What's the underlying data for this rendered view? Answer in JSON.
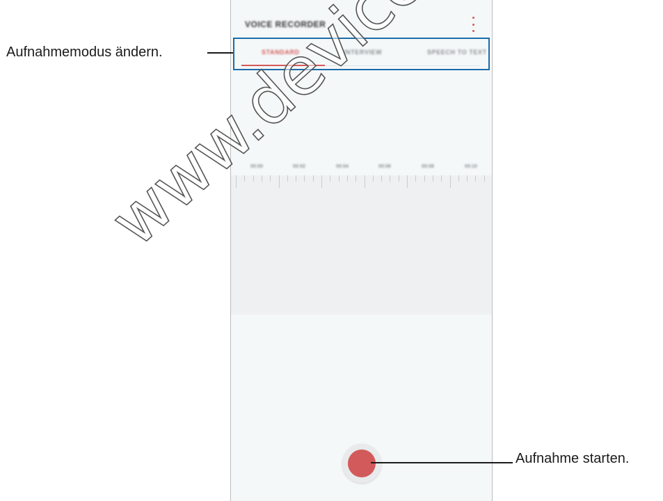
{
  "app": {
    "title": "VOICE RECORDER",
    "menu_icon": "more-vertical-icon"
  },
  "tabs": [
    {
      "label": "STANDARD",
      "active": true
    },
    {
      "label": "INTERVIEW",
      "active": false
    },
    {
      "label": "SPEECH TO TEXT",
      "active": false
    }
  ],
  "timeline": {
    "labels": [
      "00:00",
      "00:02",
      "00:04",
      "00:06",
      "00:08",
      "00:10"
    ]
  },
  "record": {
    "icon": "record-icon"
  },
  "callouts": {
    "mode": "Aufnahmemodus ändern.",
    "start": "Aufnahme starten."
  },
  "watermark": "www.devicemanuals",
  "colors": {
    "accent": "#d35a58",
    "highlight": "#1a6ca8",
    "background": "#f5f8f9"
  }
}
